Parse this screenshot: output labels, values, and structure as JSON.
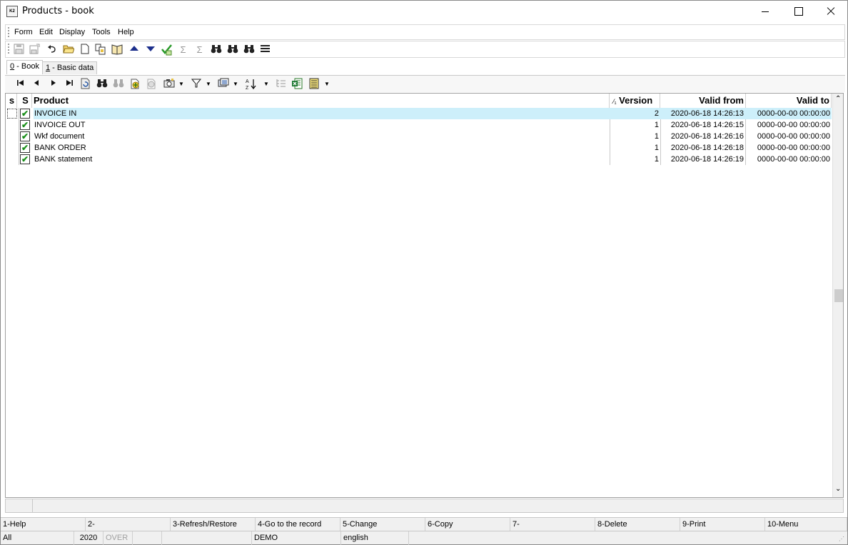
{
  "window": {
    "app_icon_text": "K2",
    "title": "Products - book"
  },
  "menu": [
    "Form",
    "Edit",
    "Display",
    "Tools",
    "Help"
  ],
  "toolbar_icons": [
    "save-icon",
    "save-as-icon",
    "undo-icon",
    "open-folder-icon",
    "new-document-icon",
    "copy-document-icon",
    "book-icon",
    "arrow-up-icon",
    "arrow-down-icon",
    "check-tree-icon",
    "sum-icon",
    "sum-filter-icon",
    "binoculars-icon",
    "binoculars-next-icon",
    "binoculars-settings-icon",
    "hamburger-menu-icon"
  ],
  "tabs": [
    {
      "key": "0",
      "label": " - Book",
      "active": true
    },
    {
      "key": "1",
      "label": " - Basic data",
      "active": false
    }
  ],
  "table": {
    "columns": {
      "s_lower": "s",
      "s_upper": "S",
      "product": "Product",
      "version_sort_glyph": "⁄₁",
      "version": "Version",
      "valid_from": "Valid from",
      "valid_to": "Valid to"
    },
    "rows": [
      {
        "checked": true,
        "product": "INVOICE IN",
        "version": "2",
        "valid_from": "2020-06-18 14:26:13",
        "valid_to": "0000-00-00 00:00:00",
        "selected": true
      },
      {
        "checked": true,
        "product": "INVOICE OUT",
        "version": "1",
        "valid_from": "2020-06-18 14:26:15",
        "valid_to": "0000-00-00 00:00:00",
        "selected": false
      },
      {
        "checked": true,
        "product": "Wkf document",
        "version": "1",
        "valid_from": "2020-06-18 14:26:16",
        "valid_to": "0000-00-00 00:00:00",
        "selected": false
      },
      {
        "checked": true,
        "product": "BANK ORDER",
        "version": "1",
        "valid_from": "2020-06-18 14:26:18",
        "valid_to": "0000-00-00 00:00:00",
        "selected": false
      },
      {
        "checked": true,
        "product": "BANK statement",
        "version": "1",
        "valid_from": "2020-06-18 14:26:19",
        "valid_to": "0000-00-00 00:00:00",
        "selected": false
      }
    ]
  },
  "function_keys": [
    "1-Help",
    "2-",
    "3-Refresh/Restore",
    "4-Go to the record",
    "5-Change",
    "6-Copy",
    "7-",
    "8-Delete",
    "9-Print",
    "10-Menu"
  ],
  "status": {
    "filter": "All",
    "year": "2020",
    "mode": "OVER",
    "database": "DEMO",
    "language": "english"
  },
  "colors": {
    "selected_row": "#cdeffa",
    "check_green": "#1a8f1a"
  }
}
